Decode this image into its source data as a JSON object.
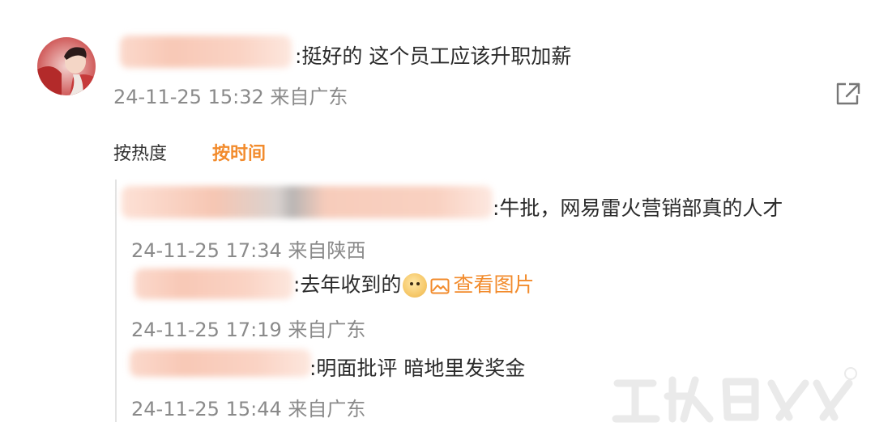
{
  "main_comment": {
    "text": ":挺好的 这个员工应该升职加薪",
    "meta": "24-11-25 15:32 来自广东",
    "share_icon": "share-external-icon"
  },
  "sort_tabs": {
    "hot": "按热度",
    "time": "按时间"
  },
  "replies": [
    {
      "text": ":牛批，网易雷火营销部真的人才",
      "meta": "24-11-25 17:34 来自陕西"
    },
    {
      "text": ":去年收到的",
      "link": "查看图片",
      "emoji": "doge-emoji",
      "link_icon": "image-icon",
      "meta": "24-11-25 17:19 来自广东"
    },
    {
      "text": ":明面批评 暗地里发奖金",
      "meta": "24-11-25 15:44 来自广东"
    }
  ],
  "colors": {
    "accent": "#f28b2c",
    "meta_gray": "#8a8a8a",
    "text": "#2b2b2b"
  }
}
